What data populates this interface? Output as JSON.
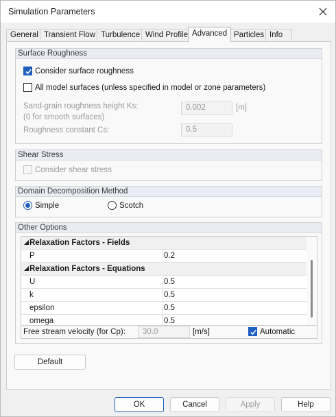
{
  "window": {
    "title": "Simulation Parameters"
  },
  "tabs": [
    "General",
    "Transient Flow",
    "Turbulence",
    "Wind Profile",
    "Advanced",
    "Particles",
    "Info"
  ],
  "surface_roughness": {
    "title": "Surface Roughness",
    "consider_label": "Consider surface roughness",
    "consider_checked": true,
    "all_surfaces_label": "All model surfaces (unless specified in model or zone parameters)",
    "all_surfaces_checked": false,
    "ks_label_line1": "Sand-grain roughness height Ks:",
    "ks_label_line2": "(0 for smooth surfaces)",
    "ks_value": "0.002",
    "ks_unit": "[m]",
    "cs_label": "Roughness constant Cs:",
    "cs_value": "0.5"
  },
  "shear_stress": {
    "title": "Shear Stress",
    "consider_label": "Consider shear stress",
    "consider_checked": false
  },
  "domain_decomposition": {
    "title": "Domain Decomposition Method",
    "simple_label": "Simple",
    "scotch_label": "Scotch",
    "selected": "Simple"
  },
  "other_options": {
    "title": "Other Options",
    "rows": [
      {
        "type": "section",
        "name": "Relaxation Factors - Fields"
      },
      {
        "type": "item",
        "name": "P",
        "value": "0.2"
      },
      {
        "type": "section",
        "name": "Relaxation Factors - Equations"
      },
      {
        "type": "item",
        "name": "U",
        "value": "0.5"
      },
      {
        "type": "item",
        "name": "k",
        "value": "0.5"
      },
      {
        "type": "item",
        "name": "epsilon",
        "value": "0.5"
      },
      {
        "type": "item",
        "name": "omega",
        "value": "0.5"
      }
    ],
    "free_stream_label": "Free stream velocity (for Cp):",
    "free_stream_value": "30.0",
    "free_stream_unit": "[m/s]",
    "automatic_label": "Automatic",
    "automatic_checked": true
  },
  "buttons": {
    "default": "Default",
    "ok": "OK",
    "cancel": "Cancel",
    "apply": "Apply",
    "help": "Help"
  },
  "colors": {
    "accent": "#1f5fbf",
    "group_header": "#e9ecf2",
    "disabled_text": "#9a9a9a"
  }
}
